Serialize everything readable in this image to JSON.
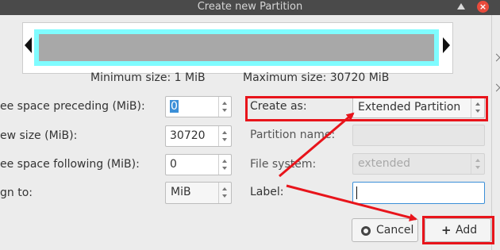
{
  "window": {
    "title": "Create new Partition"
  },
  "sizes": {
    "minimum_label": "Minimum size: 1 MiB",
    "maximum_label": "Maximum size: 30720 MiB"
  },
  "left_form": {
    "free_before": {
      "label": "ee space preceding (MiB):",
      "value": "0"
    },
    "new_size": {
      "label": "ew size (MiB):",
      "value": "30720"
    },
    "free_after": {
      "label": "ee space following (MiB):",
      "value": "0"
    },
    "align_to": {
      "label": "gn to:",
      "value": "MiB"
    }
  },
  "right_form": {
    "create_as": {
      "label": "Create as:",
      "value": "Extended Partition"
    },
    "partition_name": {
      "label": "Partition name:",
      "value": ""
    },
    "file_system": {
      "label": "File system:",
      "value": "extended"
    },
    "label_field": {
      "label": "Label:",
      "value": ""
    }
  },
  "buttons": {
    "cancel_label": "Cancel",
    "add_label": "Add",
    "add_icon": "+"
  },
  "icons": {
    "titlebar_up": "chevron-up-icon",
    "titlebar_close": "close-icon"
  },
  "colors": {
    "annotation": "#e8141b",
    "partition_border": "#7ffcff",
    "selection": "#3b8fd8"
  }
}
